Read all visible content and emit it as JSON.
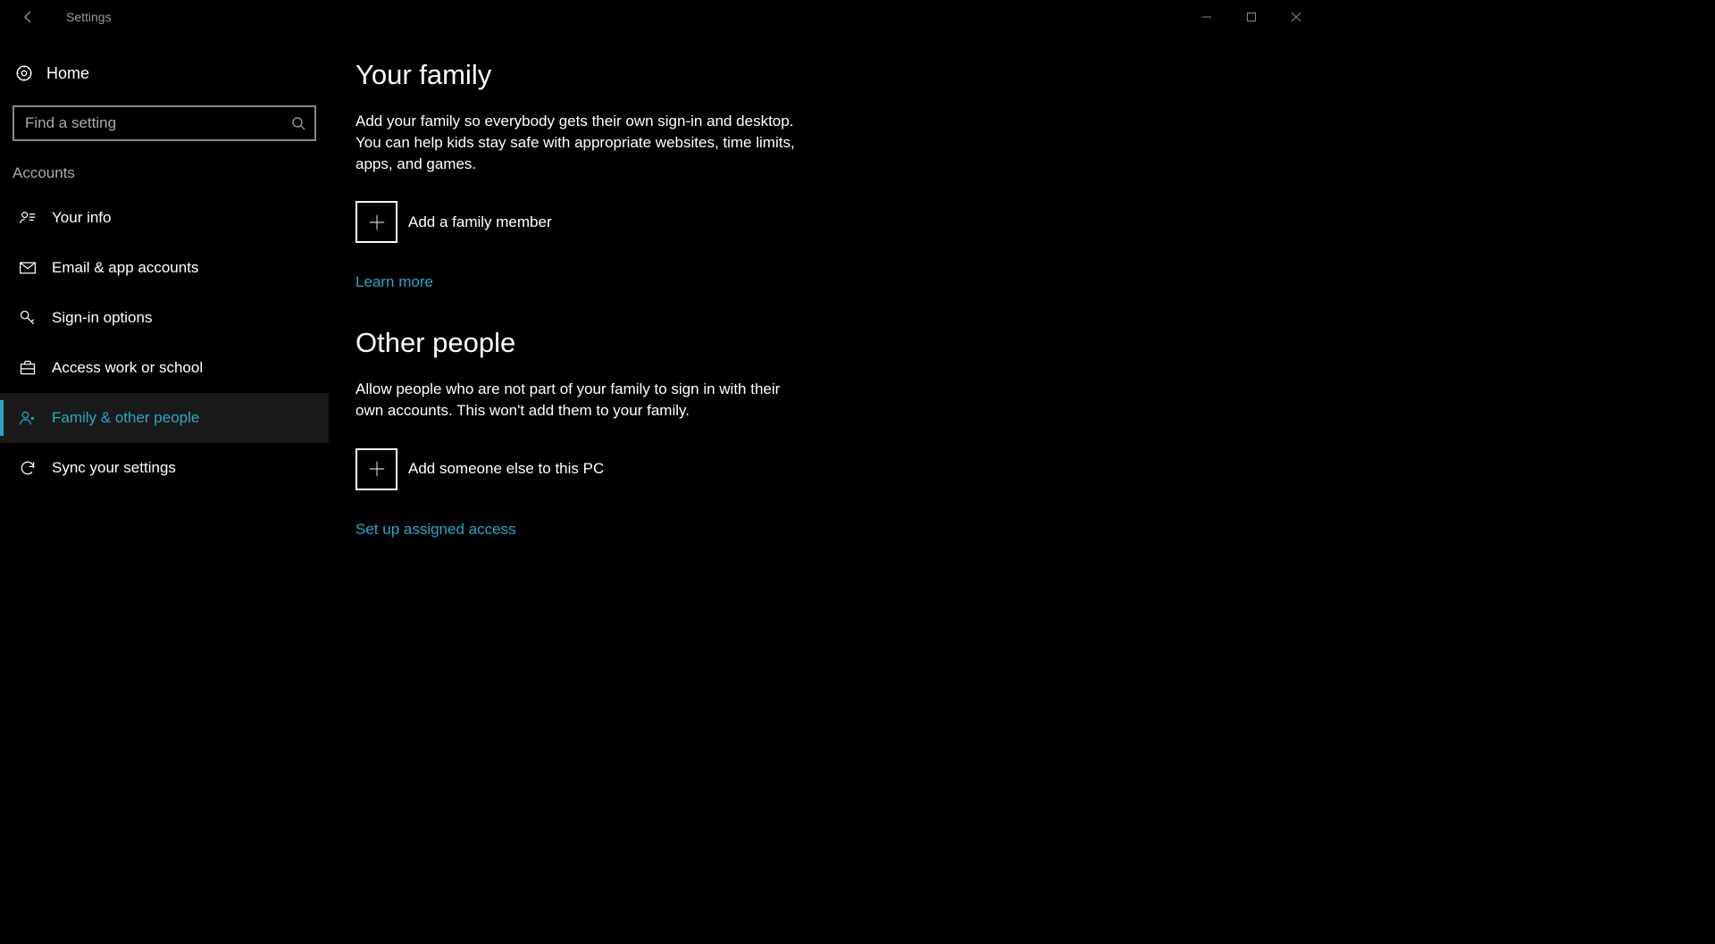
{
  "titlebar": {
    "title": "Settings"
  },
  "sidebar": {
    "home_label": "Home",
    "search_placeholder": "Find a setting",
    "group_label": "Accounts",
    "items": [
      {
        "label": "Your info"
      },
      {
        "label": "Email & app accounts"
      },
      {
        "label": "Sign-in options"
      },
      {
        "label": "Access work or school"
      },
      {
        "label": "Family & other people"
      },
      {
        "label": "Sync your settings"
      }
    ]
  },
  "main": {
    "your_family": {
      "heading": "Your family",
      "desc": "Add your family so everybody gets their own sign-in and desktop. You can help kids stay safe with appropriate websites, time limits, apps, and games.",
      "add_label": "Add a family member",
      "link": "Learn more"
    },
    "other_people": {
      "heading": "Other people",
      "desc": "Allow people who are not part of your family to sign in with their own accounts. This won't add them to your family.",
      "add_label": "Add someone else to this PC",
      "link": "Set up assigned access"
    }
  }
}
